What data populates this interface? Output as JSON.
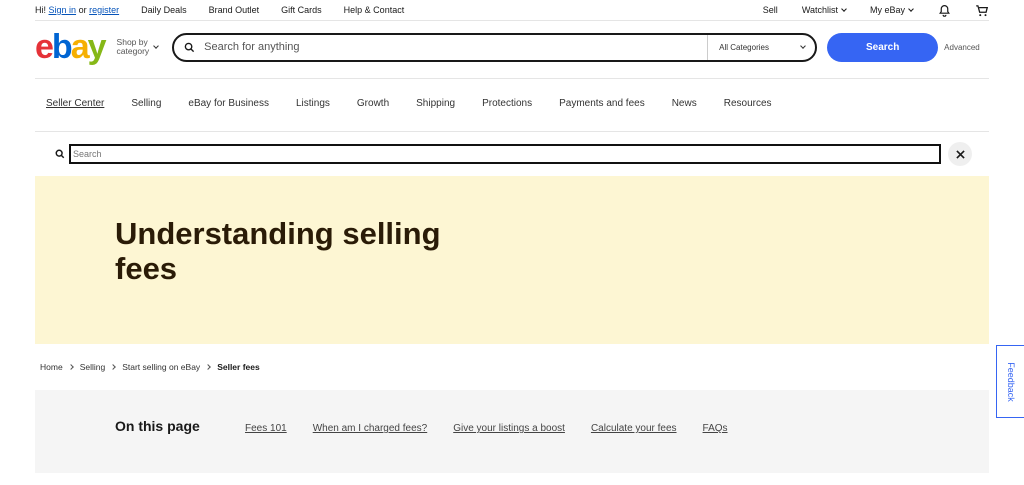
{
  "topbar": {
    "greeting": "Hi!",
    "sign_in": "Sign in",
    "or": "or",
    "register": "register",
    "links": [
      "Daily Deals",
      "Brand Outlet",
      "Gift Cards",
      "Help & Contact"
    ],
    "sell": "Sell",
    "watchlist": "Watchlist",
    "my_ebay": "My eBay"
  },
  "header": {
    "logo": {
      "e": "e",
      "b": "b",
      "a": "a",
      "y": "y"
    },
    "shop_by": "Shop by",
    "category": "category",
    "search_placeholder": "Search for anything",
    "category_select": "All Categories",
    "search_button": "Search",
    "advanced": "Advanced"
  },
  "subnav": {
    "items": [
      "Seller Center",
      "Selling",
      "eBay for Business",
      "Listings",
      "Growth",
      "Shipping",
      "Protections",
      "Payments and fees",
      "News",
      "Resources"
    ]
  },
  "page_search": {
    "placeholder": "Search"
  },
  "hero": {
    "title": "Understanding selling fees"
  },
  "breadcrumb": {
    "items": [
      "Home",
      "Selling",
      "Start selling on eBay"
    ],
    "current": "Seller fees"
  },
  "on_this_page": {
    "heading": "On this page",
    "links": [
      "Fees 101",
      "When am I charged fees?",
      "Give your listings a boost",
      "Calculate your fees",
      "FAQs"
    ]
  },
  "feedback": {
    "label": "Feedback"
  },
  "colors": {
    "accent": "#3665f3",
    "hero_bg": "#fdf6d3",
    "section_bg": "#f5f5f5"
  },
  "icons": [
    "search-icon",
    "bell-icon",
    "cart-icon",
    "close-icon",
    "chevron-down-icon",
    "chevron-right-icon"
  ]
}
